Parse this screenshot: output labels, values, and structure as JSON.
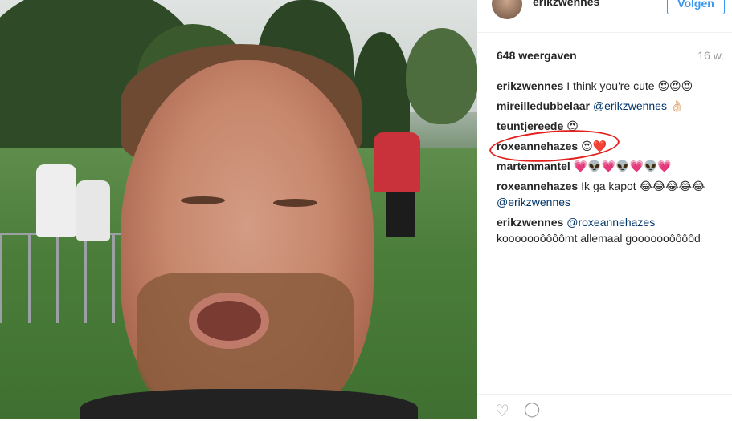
{
  "post": {
    "username": "erikzwennes",
    "follow_label": "Volgen",
    "views": "648 weergaven",
    "age": "16 w."
  },
  "comments": [
    {
      "user": "erikzwennes",
      "text": "I think you're cute 😍😍😍"
    },
    {
      "user": "mireilledubbelaar",
      "mention": "@erikzwennes",
      "text": " 👌🏻"
    },
    {
      "user": "teuntjereede",
      "text": "😍"
    },
    {
      "user": "roxeannehazes",
      "text": "😍❤️"
    },
    {
      "user": "martenmantel",
      "text": "💗👽💗👽💗👽💗"
    },
    {
      "user": "roxeannehazes",
      "text": "Ik ga kapot 😂😂😂😂😂",
      "mention_after": "@erikzwennes"
    },
    {
      "user": "erikzwennes",
      "mention": "@roxeannehazes",
      "text": "kooooooôôôômt allemaal gooooooôôôôd"
    }
  ],
  "icons": {
    "like": "heart-icon",
    "comment": "comment-icon"
  },
  "colors": {
    "accent": "#3897f0",
    "highlight": "#e2211c",
    "mention": "#003569"
  }
}
